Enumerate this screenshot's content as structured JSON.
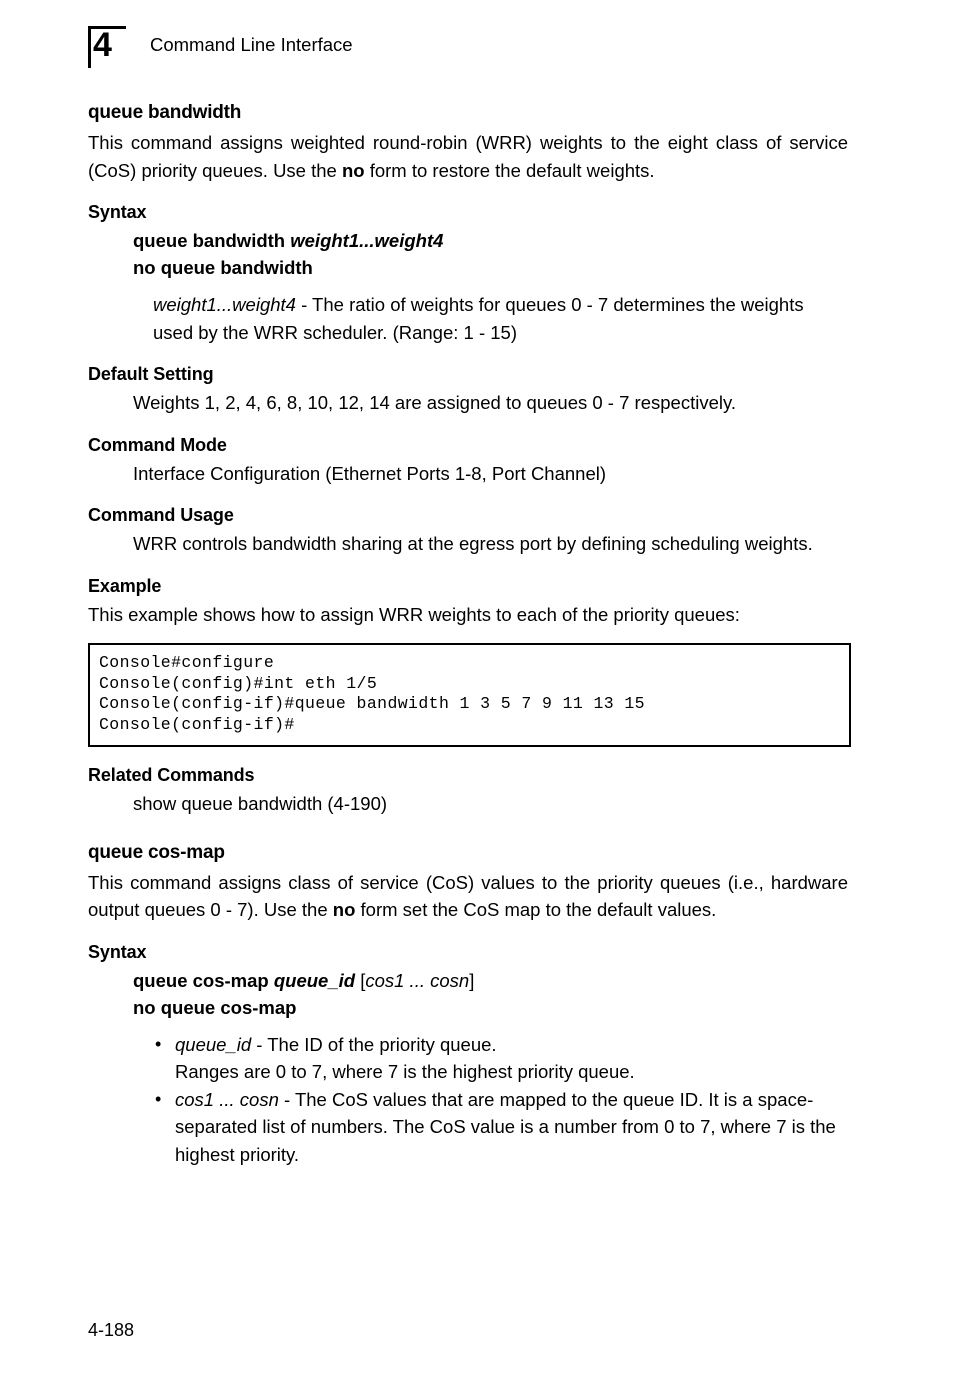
{
  "header": {
    "chapter_number": "4",
    "title": "Command Line Interface"
  },
  "footer": {
    "page_number": "4-188"
  },
  "commands": [
    {
      "title": "queue bandwidth",
      "description_parts": {
        "before": "This command assigns weighted round-robin (WRR) weights to the eight class of service (CoS) priority queues. Use the ",
        "bold": "no",
        "after": " form to restore the default weights."
      },
      "sections": {
        "syntax_label": "Syntax",
        "syntax_lines": [
          {
            "bold": "queue bandwidth ",
            "italic": "weight1...weight4"
          },
          {
            "bold": "no queue bandwidth",
            "italic": ""
          }
        ],
        "syntax_param": {
          "italic": "weight1...weight4",
          "text": " - The ratio of weights for queues 0 - 7 determines the weights used by the WRR scheduler. (Range: 1 - 15)"
        },
        "default_setting_label": "Default Setting",
        "default_setting_text": "Weights 1, 2, 4, 6, 8, 10, 12, 14 are assigned to queues 0 - 7 respectively.",
        "command_mode_label": "Command Mode",
        "command_mode_text": "Interface Configuration (Ethernet Ports 1-8, Port Channel)",
        "command_usage_label": "Command Usage",
        "command_usage_text": "WRR controls bandwidth sharing at the egress port by defining scheduling weights.",
        "example_label": "Example",
        "example_text": "This example shows how to assign WRR weights to each of the priority queues:",
        "console_output": "Console#configure\nConsole(config)#int eth 1/5\nConsole(config-if)#queue bandwidth 1 3 5 7 9 11 13 15\nConsole(config-if)#",
        "related_commands_label": "Related Commands",
        "related_commands_text": "show queue bandwidth (4-190)"
      }
    },
    {
      "title": "queue cos-map",
      "description_parts": {
        "before": "This command assigns class of service (CoS) values to the priority queues (i.e., hardware output queues 0 - 7). Use the ",
        "bold": "no",
        "after": " form set the CoS map to the default values."
      },
      "sections": {
        "syntax_label": "Syntax",
        "syntax_lines": [
          {
            "bold": "queue cos-map ",
            "italic": "queue_id",
            "roman_open": " [",
            "italic2": "cos1 ... cosn",
            "roman_close": "]"
          },
          {
            "bold": "no queue cos-map",
            "italic": ""
          }
        ],
        "bullets": [
          {
            "italic": "queue_id",
            "text": " - The ID of the priority queue.",
            "second_line": "Ranges are 0 to 7, where 7 is the highest priority queue."
          },
          {
            "italic": "cos1 ... cosn",
            "text": " - The CoS values that are mapped to the queue ID. It is a space-separated list of numbers. The CoS value is a number from 0 to 7, where 7 is the highest priority.",
            "second_line": ""
          }
        ]
      }
    }
  ]
}
